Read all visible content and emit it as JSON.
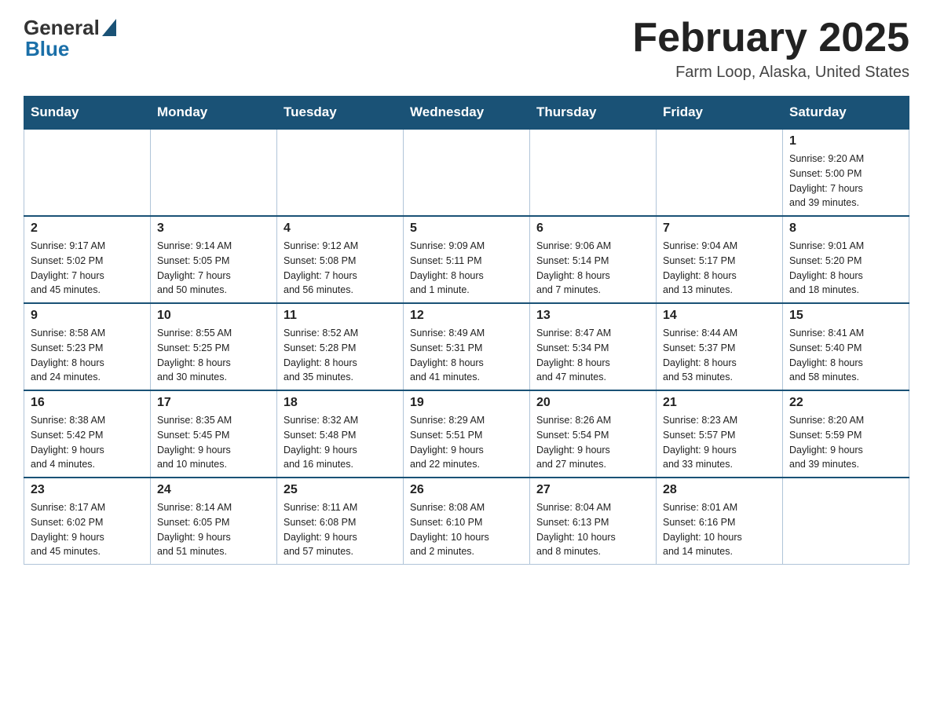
{
  "logo": {
    "general": "General",
    "blue": "Blue"
  },
  "header": {
    "month": "February 2025",
    "location": "Farm Loop, Alaska, United States"
  },
  "weekdays": [
    "Sunday",
    "Monday",
    "Tuesday",
    "Wednesday",
    "Thursday",
    "Friday",
    "Saturday"
  ],
  "weeks": [
    [
      {
        "day": "",
        "info": ""
      },
      {
        "day": "",
        "info": ""
      },
      {
        "day": "",
        "info": ""
      },
      {
        "day": "",
        "info": ""
      },
      {
        "day": "",
        "info": ""
      },
      {
        "day": "",
        "info": ""
      },
      {
        "day": "1",
        "info": "Sunrise: 9:20 AM\nSunset: 5:00 PM\nDaylight: 7 hours\nand 39 minutes."
      }
    ],
    [
      {
        "day": "2",
        "info": "Sunrise: 9:17 AM\nSunset: 5:02 PM\nDaylight: 7 hours\nand 45 minutes."
      },
      {
        "day": "3",
        "info": "Sunrise: 9:14 AM\nSunset: 5:05 PM\nDaylight: 7 hours\nand 50 minutes."
      },
      {
        "day": "4",
        "info": "Sunrise: 9:12 AM\nSunset: 5:08 PM\nDaylight: 7 hours\nand 56 minutes."
      },
      {
        "day": "5",
        "info": "Sunrise: 9:09 AM\nSunset: 5:11 PM\nDaylight: 8 hours\nand 1 minute."
      },
      {
        "day": "6",
        "info": "Sunrise: 9:06 AM\nSunset: 5:14 PM\nDaylight: 8 hours\nand 7 minutes."
      },
      {
        "day": "7",
        "info": "Sunrise: 9:04 AM\nSunset: 5:17 PM\nDaylight: 8 hours\nand 13 minutes."
      },
      {
        "day": "8",
        "info": "Sunrise: 9:01 AM\nSunset: 5:20 PM\nDaylight: 8 hours\nand 18 minutes."
      }
    ],
    [
      {
        "day": "9",
        "info": "Sunrise: 8:58 AM\nSunset: 5:23 PM\nDaylight: 8 hours\nand 24 minutes."
      },
      {
        "day": "10",
        "info": "Sunrise: 8:55 AM\nSunset: 5:25 PM\nDaylight: 8 hours\nand 30 minutes."
      },
      {
        "day": "11",
        "info": "Sunrise: 8:52 AM\nSunset: 5:28 PM\nDaylight: 8 hours\nand 35 minutes."
      },
      {
        "day": "12",
        "info": "Sunrise: 8:49 AM\nSunset: 5:31 PM\nDaylight: 8 hours\nand 41 minutes."
      },
      {
        "day": "13",
        "info": "Sunrise: 8:47 AM\nSunset: 5:34 PM\nDaylight: 8 hours\nand 47 minutes."
      },
      {
        "day": "14",
        "info": "Sunrise: 8:44 AM\nSunset: 5:37 PM\nDaylight: 8 hours\nand 53 minutes."
      },
      {
        "day": "15",
        "info": "Sunrise: 8:41 AM\nSunset: 5:40 PM\nDaylight: 8 hours\nand 58 minutes."
      }
    ],
    [
      {
        "day": "16",
        "info": "Sunrise: 8:38 AM\nSunset: 5:42 PM\nDaylight: 9 hours\nand 4 minutes."
      },
      {
        "day": "17",
        "info": "Sunrise: 8:35 AM\nSunset: 5:45 PM\nDaylight: 9 hours\nand 10 minutes."
      },
      {
        "day": "18",
        "info": "Sunrise: 8:32 AM\nSunset: 5:48 PM\nDaylight: 9 hours\nand 16 minutes."
      },
      {
        "day": "19",
        "info": "Sunrise: 8:29 AM\nSunset: 5:51 PM\nDaylight: 9 hours\nand 22 minutes."
      },
      {
        "day": "20",
        "info": "Sunrise: 8:26 AM\nSunset: 5:54 PM\nDaylight: 9 hours\nand 27 minutes."
      },
      {
        "day": "21",
        "info": "Sunrise: 8:23 AM\nSunset: 5:57 PM\nDaylight: 9 hours\nand 33 minutes."
      },
      {
        "day": "22",
        "info": "Sunrise: 8:20 AM\nSunset: 5:59 PM\nDaylight: 9 hours\nand 39 minutes."
      }
    ],
    [
      {
        "day": "23",
        "info": "Sunrise: 8:17 AM\nSunset: 6:02 PM\nDaylight: 9 hours\nand 45 minutes."
      },
      {
        "day": "24",
        "info": "Sunrise: 8:14 AM\nSunset: 6:05 PM\nDaylight: 9 hours\nand 51 minutes."
      },
      {
        "day": "25",
        "info": "Sunrise: 8:11 AM\nSunset: 6:08 PM\nDaylight: 9 hours\nand 57 minutes."
      },
      {
        "day": "26",
        "info": "Sunrise: 8:08 AM\nSunset: 6:10 PM\nDaylight: 10 hours\nand 2 minutes."
      },
      {
        "day": "27",
        "info": "Sunrise: 8:04 AM\nSunset: 6:13 PM\nDaylight: 10 hours\nand 8 minutes."
      },
      {
        "day": "28",
        "info": "Sunrise: 8:01 AM\nSunset: 6:16 PM\nDaylight: 10 hours\nand 14 minutes."
      },
      {
        "day": "",
        "info": ""
      }
    ]
  ]
}
